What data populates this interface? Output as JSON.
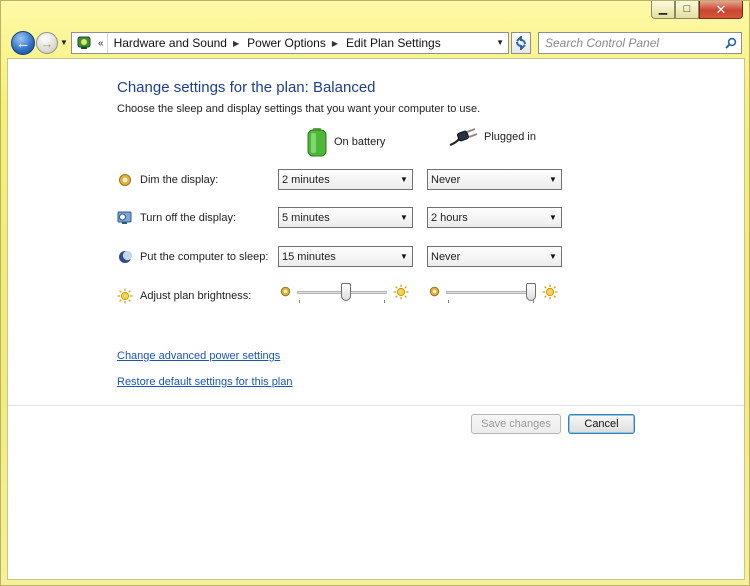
{
  "toolbar": {
    "breadcrumb": [
      "Hardware and Sound",
      "Power Options",
      "Edit Plan Settings"
    ],
    "search_placeholder": "Search Control Panel"
  },
  "page": {
    "title": "Change settings for the plan: Balanced",
    "subtitle": "Choose the sleep and display settings that you want your computer to use.",
    "columns": {
      "battery": "On battery",
      "plugged": "Plugged in"
    },
    "rows": [
      {
        "label": "Dim the display:",
        "battery": "2 minutes",
        "plugged": "Never"
      },
      {
        "label": "Turn off the display:",
        "battery": "5 minutes",
        "plugged": "2 hours"
      },
      {
        "label": "Put the computer to sleep:",
        "battery": "15 minutes",
        "plugged": "Never"
      }
    ],
    "brightness": {
      "label": "Adjust plan brightness:",
      "battery_level": 0.55,
      "plugged_level": 1.0
    },
    "links": {
      "advanced": "Change advanced power settings",
      "restore": "Restore default settings for this plan"
    },
    "buttons": {
      "save": "Save changes",
      "cancel": "Cancel"
    }
  },
  "colors": {
    "frame": "#f3ee8c",
    "title": "#1e3f8c",
    "link": "#1a55b8",
    "close": "#c9452e"
  }
}
